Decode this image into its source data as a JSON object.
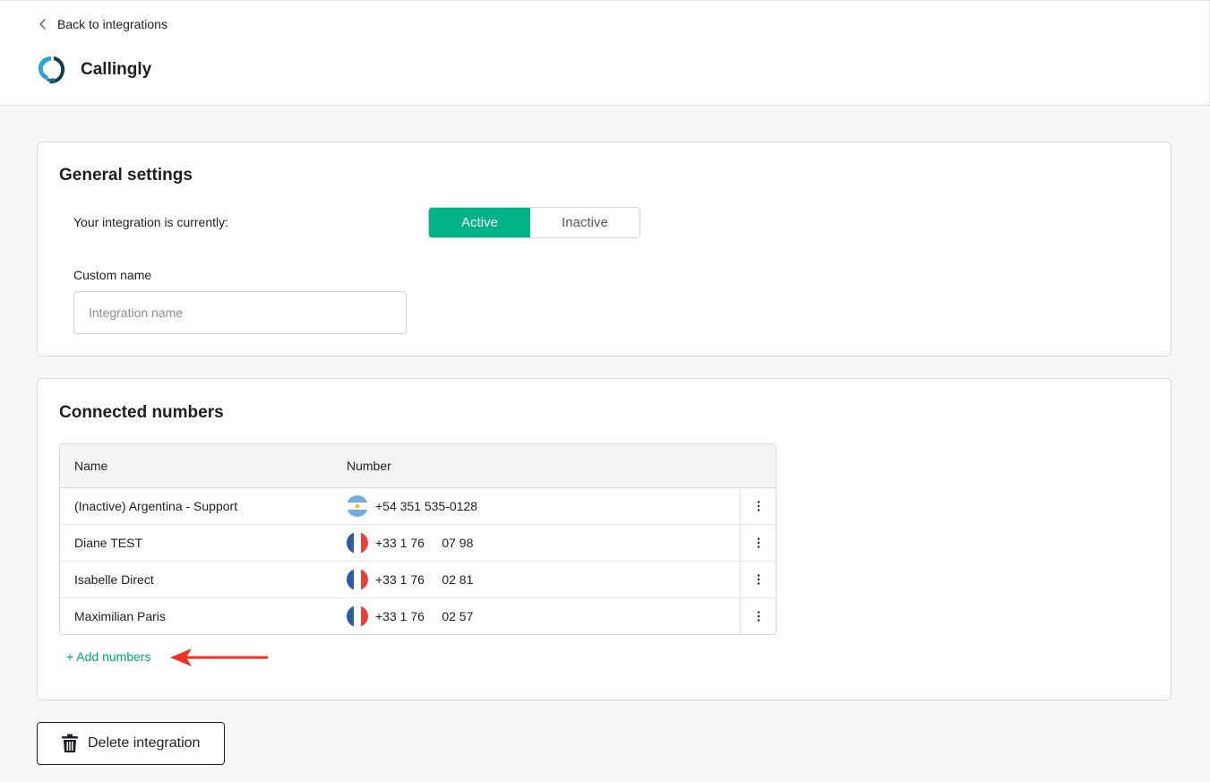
{
  "header": {
    "back_label": "Back to integrations",
    "app_name": "Callingly",
    "logo_icon": "callingly-logo-icon"
  },
  "general": {
    "title": "General settings",
    "status_label": "Your integration is currently:",
    "status_options": [
      "Active",
      "Inactive"
    ],
    "status_selected": "Active",
    "custom_name_label": "Custom name",
    "custom_name_value": "",
    "custom_name_placeholder": "Integration name"
  },
  "numbers": {
    "title": "Connected numbers",
    "columns": [
      "Name",
      "Number"
    ],
    "rows": [
      {
        "name": "(Inactive) Argentina - Support",
        "number": "+54 351 535-0128",
        "flag_icon": "argentina-flag-icon"
      },
      {
        "name": "Diane TEST",
        "number": "+33 1 76     07 98",
        "flag_icon": "france-flag-icon"
      },
      {
        "name": "Isabelle Direct",
        "number": "+33 1 76     02 81",
        "flag_icon": "france-flag-icon"
      },
      {
        "name": "Maximilian Paris",
        "number": "+33 1 76     02 57",
        "flag_icon": "france-flag-icon"
      }
    ],
    "add_label": "+ Add numbers"
  },
  "delete_label": "Delete integration",
  "colors": {
    "accent": "#00b386",
    "link": "#00a67c",
    "annotation_arrow": "#ee3124"
  }
}
